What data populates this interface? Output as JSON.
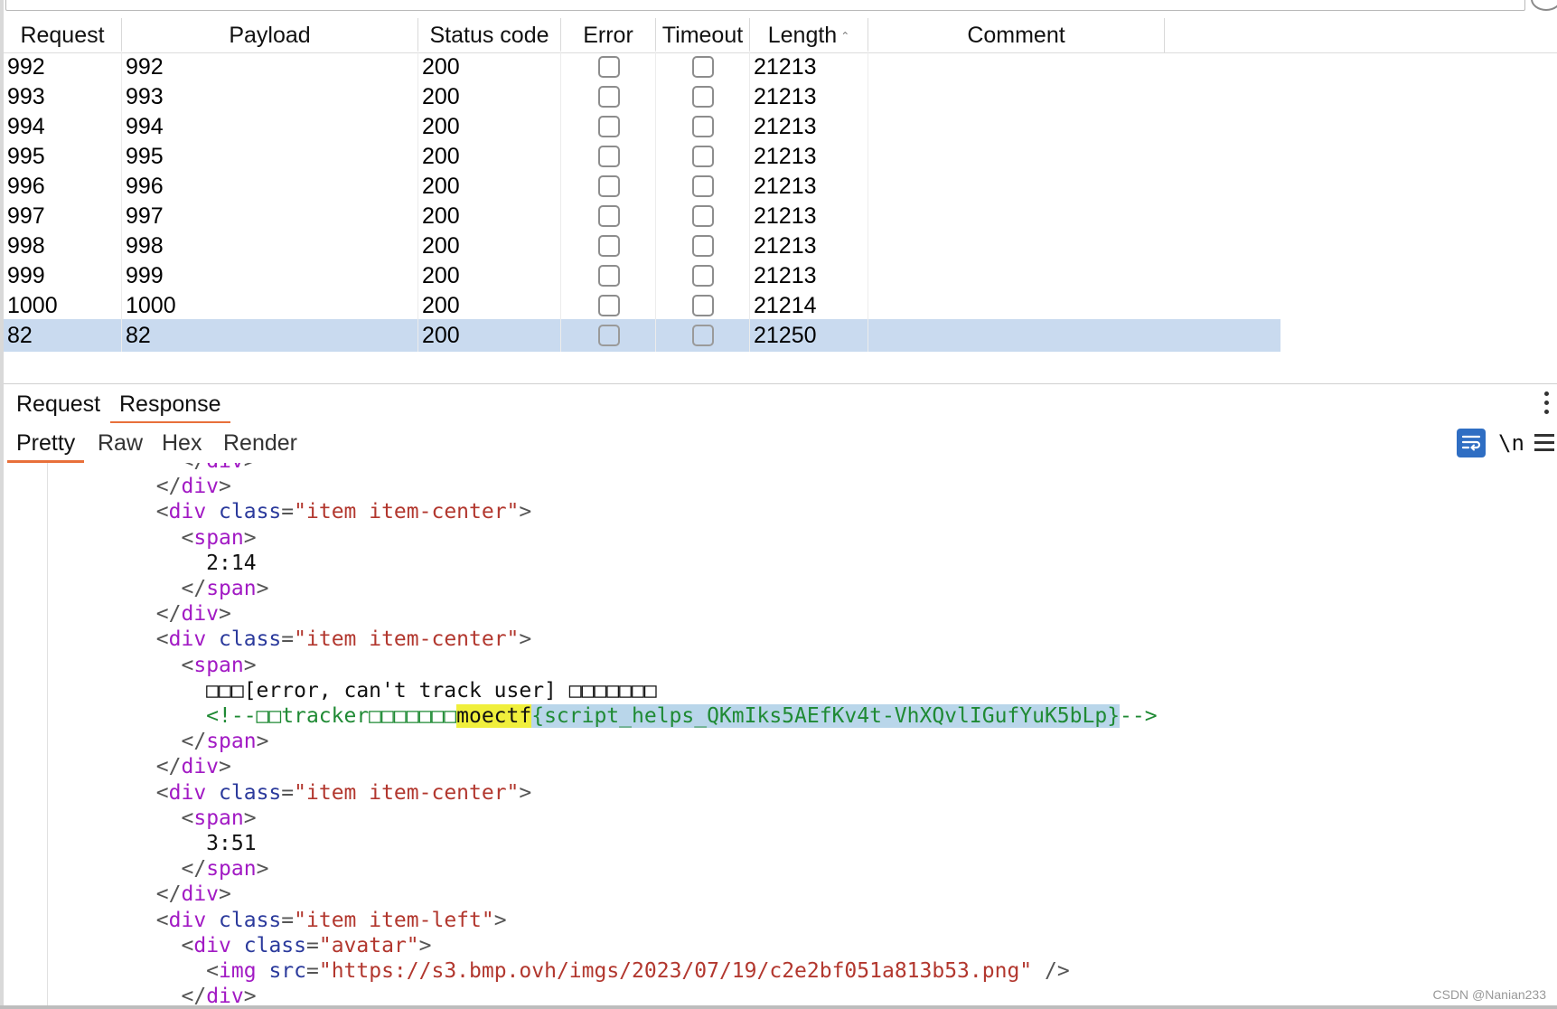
{
  "table": {
    "columns": [
      {
        "label": "Request"
      },
      {
        "label": "Payload"
      },
      {
        "label": "Status code"
      },
      {
        "label": "Error"
      },
      {
        "label": "Timeout"
      },
      {
        "label": "Length",
        "sort": "ascending"
      },
      {
        "label": "Comment"
      }
    ],
    "rows": [
      {
        "request": "992",
        "payload": "992",
        "status": "200",
        "error": false,
        "timeout": false,
        "length": "21213",
        "comment": ""
      },
      {
        "request": "993",
        "payload": "993",
        "status": "200",
        "error": false,
        "timeout": false,
        "length": "21213",
        "comment": ""
      },
      {
        "request": "994",
        "payload": "994",
        "status": "200",
        "error": false,
        "timeout": false,
        "length": "21213",
        "comment": ""
      },
      {
        "request": "995",
        "payload": "995",
        "status": "200",
        "error": false,
        "timeout": false,
        "length": "21213",
        "comment": ""
      },
      {
        "request": "996",
        "payload": "996",
        "status": "200",
        "error": false,
        "timeout": false,
        "length": "21213",
        "comment": ""
      },
      {
        "request": "997",
        "payload": "997",
        "status": "200",
        "error": false,
        "timeout": false,
        "length": "21213",
        "comment": ""
      },
      {
        "request": "998",
        "payload": "998",
        "status": "200",
        "error": false,
        "timeout": false,
        "length": "21213",
        "comment": ""
      },
      {
        "request": "999",
        "payload": "999",
        "status": "200",
        "error": false,
        "timeout": false,
        "length": "21213",
        "comment": ""
      },
      {
        "request": "1000",
        "payload": "1000",
        "status": "200",
        "error": false,
        "timeout": false,
        "length": "21214",
        "comment": ""
      },
      {
        "request": "82",
        "payload": "82",
        "status": "200",
        "error": false,
        "timeout": false,
        "length": "21250",
        "comment": "",
        "selected": true
      }
    ]
  },
  "message_tabs": {
    "request_label": "Request",
    "response_label": "Response",
    "active": "Response"
  },
  "view_tabs": {
    "pretty_label": "Pretty",
    "raw_label": "Raw",
    "hex_label": "Hex",
    "render_label": "Render",
    "active": "Pretty",
    "newline_toggle_label": "\\n"
  },
  "code": {
    "lines": [
      "          </div>",
      "        </div>",
      "        <div class=\"item item-center\">",
      "          <span>",
      "            2:14",
      "          </span>",
      "        </div>",
      "        <div class=\"item item-center\">",
      "          <span>",
      "            □□□[error, can't track user] □□□□□□□",
      "            <!--□□tracker□□□□□□□moectf{script_helps_QKmIks5AEfKv4t-VhXQvlIGufYuK5bLp}-->",
      "          </span>",
      "        </div>",
      "        <div class=\"item item-center\">",
      "          <span>",
      "            3:51",
      "          </span>",
      "        </div>",
      "        <div class=\"item item-left\">",
      "          <div class=\"avatar\">",
      "            <img src=\"https://s3.bmp.ovh/imgs/2023/07/19/c2e2bf051a813b53.png\" />",
      "          </div>"
    ],
    "comment_prefix": "<!--□□tracker□□□□□□□",
    "search_match": "moectf",
    "flag_rest": "{script_helps_QKmIks5AEfKv4t-VhXQvlIGufYuK5bLp}",
    "comment_suffix": "-->"
  },
  "watermark": "CSDN @Nanian233",
  "colors": {
    "selected_row": "#c9daef",
    "active_tab_underline": "#e8703a",
    "tag": "#a21ac4",
    "attribute": "#2b3a9c",
    "value": "#b2372e",
    "comment": "#1f8a34",
    "search_highlight": "#f0ef3c",
    "selection_highlight": "#b9d6ea",
    "wrap_button": "#2f6ec3"
  },
  "icons": {
    "sort": "sort-ascending-icon",
    "kebab": "kebab-menu-icon",
    "wrap": "text-wrap-icon",
    "menu": "hamburger-menu-icon"
  }
}
